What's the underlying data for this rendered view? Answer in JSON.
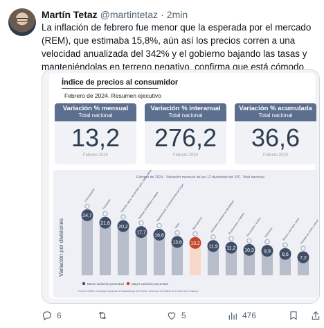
{
  "tweet": {
    "author_name": "Martín Tetaz",
    "handle": "@martintetaz",
    "separator": "·",
    "time": "2min",
    "text": "La inflación de febrero fue menor que la esperada por el mercado (REM), que estimaba 15,8%, aún así los precios corren a una velocidad anualizada del 342% y el gobierno bajando las tasas y manteniéndolas en terreno negativo, confirma que está cómodo con la baja gradual; le sirve"
  },
  "infographic": {
    "title": "Índice de precios al consumidor",
    "subtitle": "Febrero de 2024. Resumen ejecutivo",
    "cards": [
      {
        "title": "Variación % mensual",
        "sub": "Total nacional",
        "value": "13,2",
        "foot": "Febrero 2024"
      },
      {
        "title": "Variación % interanual",
        "sub": "Total nacional",
        "value": "276,2",
        "foot": "Febrero 2024"
      },
      {
        "title": "Variación % acumulada",
        "sub": "Total nacional",
        "value": "36,6",
        "foot": "Febrero 2024"
      }
    ]
  },
  "chart_data": {
    "type": "bar",
    "title": "Febrero de 2024 · Variación mensual de las 12 divisiones del IPC. Total nacional",
    "ylabel": "Variación por divisiones",
    "ylim": [
      0,
      30
    ],
    "categories": [
      "Comunicación",
      "Transporte",
      "Vivienda, agua, electricidad, gas y otros combustibles",
      "Bebidas alcohólicas y tabaco",
      "Equipamiento y mantenimiento del hogar",
      "Salud",
      "Nivel general",
      "Alimentos y bebidas no alcohólicas",
      "Restaurantes y hoteles",
      "Recreación y cultura",
      "Educación",
      "Bienes y servicios varios",
      "Prendas de vestir y calzado"
    ],
    "values": [
      24.7,
      21.6,
      20.2,
      17.7,
      16.6,
      13.6,
      13.2,
      11.9,
      11.2,
      10.3,
      9.9,
      8.6,
      7.2
    ],
    "value_labels": [
      "24,7",
      "21,6",
      "20,2",
      "17,7",
      "16,6",
      "13,6",
      "13,2",
      "11,9",
      "11,2",
      "10,3",
      "9,9",
      "8,6",
      "7,2"
    ],
    "highlight_label": "Nivel general",
    "legend": [
      "Mayor variación porcentual",
      "Menor variación porcentual"
    ],
    "source": "Fuente: INDEC, Dirección Nacional de Estadísticas de Precios. Dirección de Índices de Precios de Consumo.",
    "colors": {
      "bar": "#b7bdca",
      "highlight": "#f7d9cc",
      "bubble": "#3f4e66",
      "bubble_highlight": "#c2452d"
    }
  },
  "actions": {
    "replies": "6",
    "retweets": "",
    "likes": "5",
    "views": "476"
  },
  "colors": {
    "muted": "#536471",
    "border": "#cfd9de"
  }
}
